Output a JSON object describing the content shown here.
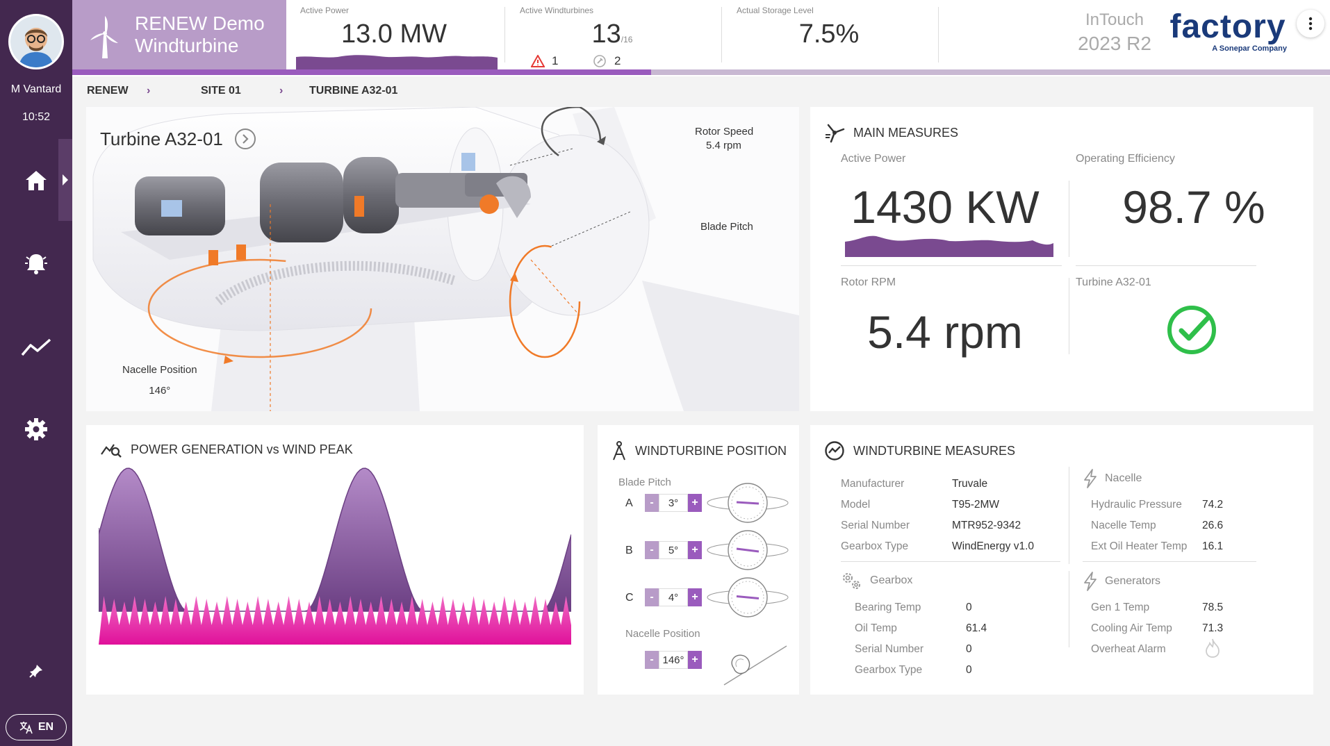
{
  "user": {
    "name": "M Vantard",
    "time": "10:52"
  },
  "nav": [
    {
      "id": "home",
      "icon": "home-icon"
    },
    {
      "id": "alarms",
      "icon": "bell-icon"
    },
    {
      "id": "trends",
      "icon": "trend-icon"
    },
    {
      "id": "settings",
      "icon": "gear-icon"
    }
  ],
  "language": "EN",
  "app": {
    "title_line1": "RENEW Demo",
    "title_line2": "Windturbine"
  },
  "header": {
    "active_power": {
      "label": "Active Power",
      "value": "13.0 MW"
    },
    "active_windturbines": {
      "label": "Active Windturbines",
      "value": "13",
      "total": "/16",
      "alarms": "1",
      "maintenance": "2"
    },
    "storage": {
      "label": "Actual Storage Level",
      "value": "7.5%"
    },
    "progress_fraction": 0.46,
    "product_line1": "InTouch",
    "product_line2": "2023 R2",
    "brand": "factory",
    "brand_sub": "A Sonepar Company"
  },
  "breadcrumb": [
    "RENEW",
    "SITE 01",
    "TURBINE A32-01"
  ],
  "turbine": {
    "title": "Turbine A32-01",
    "rotor_speed_label": "Rotor Speed",
    "rotor_speed_value": "5.4 rpm",
    "blade_pitch_label": "Blade Pitch",
    "nacelle_label": "Nacelle Position",
    "nacelle_value": "146°"
  },
  "main_measures": {
    "title": "MAIN MEASURES",
    "active_power_label": "Active Power",
    "active_power_value": "1430 KW",
    "efficiency_label": "Operating Efficiency",
    "efficiency_value": "98.7 %",
    "rotor_label": "Rotor RPM",
    "rotor_value": "5.4 rpm",
    "status_label": "Turbine A32-01",
    "status_ok": true
  },
  "power_chart": {
    "title": "POWER GENERATION vs WIND PEAK"
  },
  "position": {
    "title": "WINDTURBINE POSITION",
    "blade_pitch_label": "Blade Pitch",
    "blades": [
      {
        "name": "A",
        "value": "3°"
      },
      {
        "name": "B",
        "value": "5°"
      },
      {
        "name": "C",
        "value": "4°"
      }
    ],
    "nacelle_label": "Nacelle Position",
    "nacelle_value": "146°",
    "minus": "-",
    "plus": "+"
  },
  "measures": {
    "title": "WINDTURBINE MEASURES",
    "general": [
      {
        "k": "Manufacturer",
        "v": "Truvale"
      },
      {
        "k": "Model",
        "v": "T95-2MW"
      },
      {
        "k": "Serial Number",
        "v": "MTR952-9342"
      },
      {
        "k": "Gearbox Type",
        "v": "WindEnergy v1.0"
      }
    ],
    "gearbox_title": "Gearbox",
    "gearbox": [
      {
        "k": "Bearing Temp",
        "v": "0"
      },
      {
        "k": "Oil Temp",
        "v": "61.4"
      },
      {
        "k": "Serial Number",
        "v": "0"
      },
      {
        "k": "Gearbox Type",
        "v": "0"
      }
    ],
    "nacelle_title": "Nacelle",
    "nacelle": [
      {
        "k": "Hydraulic Pressure",
        "v": "74.2"
      },
      {
        "k": "Nacelle Temp",
        "v": "26.6"
      },
      {
        "k": "Ext Oil Heater Temp",
        "v": "16.1"
      }
    ],
    "generators_title": "Generators",
    "generators": [
      {
        "k": "Gen 1 Temp",
        "v": "78.5"
      },
      {
        "k": "Cooling Air Temp",
        "v": "71.3"
      },
      {
        "k": "Overheat Alarm",
        "v": ""
      }
    ]
  },
  "colors": {
    "sidebar": "#43284f",
    "accent": "#9a5bbd",
    "tile": "#b89cc8",
    "ok": "#2fbf4a",
    "magenta": "#e0189a"
  }
}
